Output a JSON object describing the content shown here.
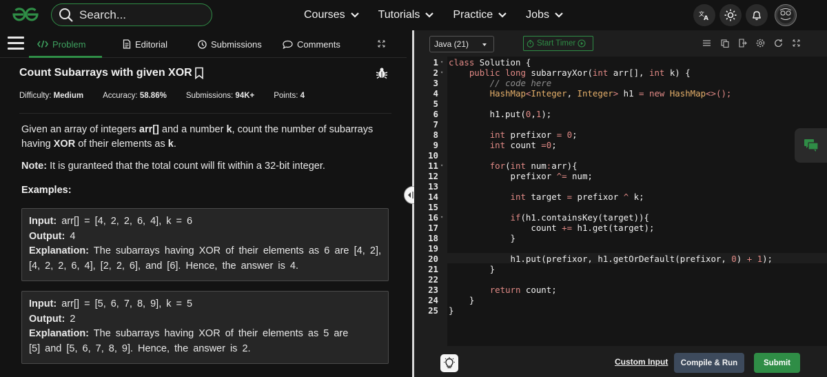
{
  "header": {
    "search_placeholder": "Search...",
    "nav": [
      {
        "label": "Courses"
      },
      {
        "label": "Tutorials"
      },
      {
        "label": "Practice"
      },
      {
        "label": "Jobs"
      }
    ],
    "brand_color": "#2f8d46"
  },
  "tabs": {
    "problem": "Problem",
    "editorial": "Editorial",
    "submissions": "Submissions",
    "comments": "Comments"
  },
  "problem": {
    "title": "Count Subarrays with given XOR",
    "meta": {
      "difficulty_label": "Difficulty:",
      "difficulty": "Medium",
      "accuracy_label": "Accuracy:",
      "accuracy": "58.86%",
      "submissions_label": "Submissions:",
      "submissions": "94K+",
      "points_label": "Points:",
      "points": "4"
    },
    "desc_1": "Given an array of integers ",
    "desc_arr": "arr[]",
    "desc_2": " and a number ",
    "desc_k": "k",
    "desc_3": ", count the number of subarrays having ",
    "desc_xor": "XOR",
    "desc_4": " of their elements as ",
    "desc_k2": "k",
    "desc_5": ".",
    "note_label": "Note:",
    "note_text": " It is guranteed that the total count will fit within a 32-bit integer.",
    "examples_label": "Examples:",
    "examples": [
      {
        "input_label": "Input:",
        "input": " arr[] = [4, 2, 2, 6, 4], k = 6",
        "output_label": "Output:",
        "output": " 4",
        "explanation_label": "Explanation:",
        "explanation": " The subarrays having XOR of their elements as 6 are [4, 2], [4, 2, 2, 6, 4], [2, 2, 6], and [6]. Hence, the answer is 4."
      },
      {
        "input_label": "Input:",
        "input": " arr[] = [5, 6, 7, 8, 9], k = 5",
        "output_label": "Output:",
        "output": " 2",
        "explanation_label": "Explanation:",
        "explanation": " The subarrays having XOR of their elements as 5 are [5] and [5, 6, 7, 8, 9]. Hence, the answer is 2."
      }
    ]
  },
  "editor": {
    "language": "Java (21)",
    "timer_label": "Start Timer",
    "line_numbers": [
      "1",
      "2",
      "3",
      "4",
      "5",
      "6",
      "7",
      "8",
      "9",
      "10",
      "11",
      "12",
      "13",
      "14",
      "15",
      "16",
      "17",
      "18",
      "19",
      "20",
      "21",
      "22",
      "23",
      "24",
      "25"
    ],
    "code_lines": [
      "class Solution {",
      "    public long subarrayXor(int arr[], int k) {",
      "        // code here",
      "        HashMap<Integer, Integer> h1 = new HashMap<>();",
      "",
      "        h1.put(0,1);",
      "",
      "        int prefixor = 0;",
      "        int count =0;",
      "",
      "        for(int num:arr){",
      "            prefixor ^= num;",
      "",
      "            int target = prefixor ^ k;",
      "",
      "            if(h1.containsKey(target)){",
      "                count += h1.get(target);",
      "            }",
      "",
      "            h1.put(prefixor, h1.getOrDefault(prefixor, 0) + 1);",
      "        }",
      "",
      "        return count;",
      "    }",
      "}"
    ]
  },
  "actions": {
    "custom_input": "Custom Input",
    "compile_run": "Compile & Run",
    "submit": "Submit"
  }
}
